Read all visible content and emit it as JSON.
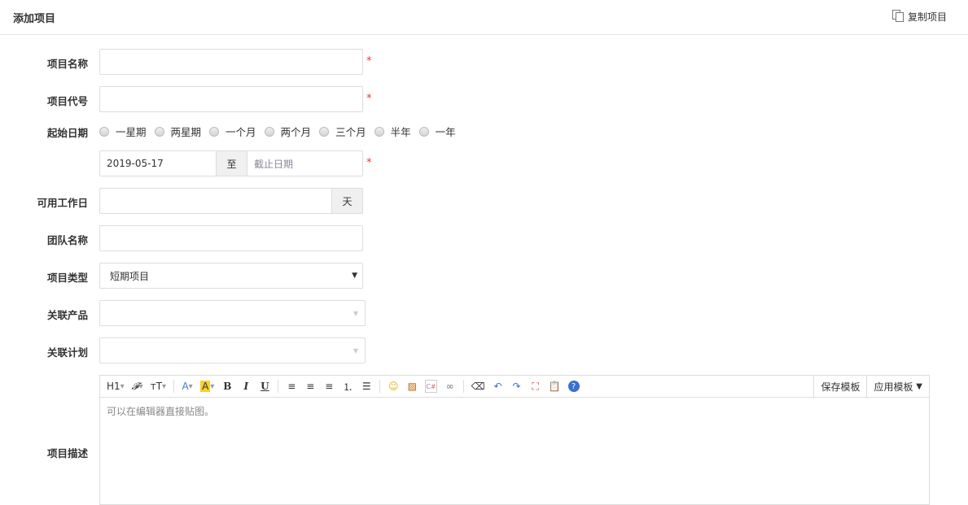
{
  "header": {
    "title": "添加项目",
    "copy_label": "复制项目"
  },
  "form": {
    "name_label": "项目名称",
    "code_label": "项目代号",
    "start_label": "起始日期",
    "durations": [
      "一星期",
      "两星期",
      "一个月",
      "两个月",
      "三个月",
      "半年",
      "一年"
    ],
    "begin_date": "2019-05-17",
    "to": "至",
    "end_placeholder": "截止日期",
    "workdays_label": "可用工作日",
    "days_unit": "天",
    "team_label": "团队名称",
    "type_label": "项目类型",
    "type_value": "短期项目",
    "product_label": "关联产品",
    "plan_label": "关联计划",
    "desc_label": "项目描述",
    "required": "*"
  },
  "editor": {
    "h1": "H1",
    "font": "𝓕",
    "size": "тT",
    "color": "A",
    "bg": "A",
    "bold": "B",
    "italic": "I",
    "underline": "U",
    "save_template": "保存模板",
    "apply_template": "应用模板",
    "placeholder": "可以在编辑器直接贴图。"
  }
}
